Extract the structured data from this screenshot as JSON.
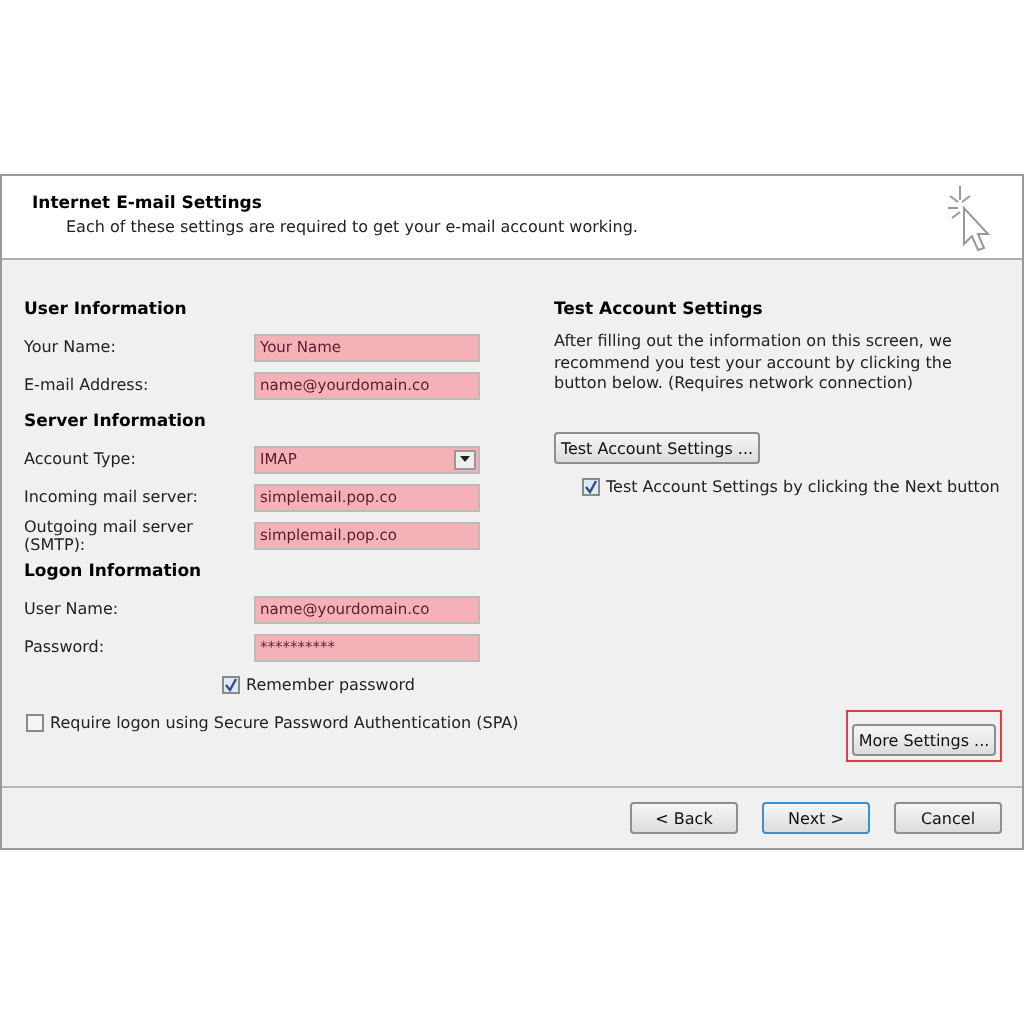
{
  "header": {
    "title": "Internet E-mail Settings",
    "subtitle": "Each of these settings are required to get your e-mail account working."
  },
  "sections": [
    {
      "title": "User Information",
      "fields": [
        {
          "kind": "text",
          "label": "Your Name:",
          "value": "Your Name",
          "highlighted": true
        },
        {
          "kind": "text",
          "label": "E-mail Address:",
          "value": "name@yourdomain.co",
          "highlighted": true
        }
      ]
    },
    {
      "title": "Server Information",
      "fields": [
        {
          "kind": "select",
          "label": "Account Type:",
          "value": "IMAP",
          "highlighted": true
        },
        {
          "kind": "text",
          "label": "Incoming mail server:",
          "value": "simplemail.pop.co",
          "highlighted": true
        },
        {
          "kind": "text",
          "label": "Outgoing mail server (SMTP):",
          "value": "simplemail.pop.co",
          "highlighted": true
        }
      ]
    },
    {
      "title": "Logon Information",
      "fields": [
        {
          "kind": "text",
          "label": "User Name:",
          "value": "name@yourdomain.co",
          "highlighted": true
        },
        {
          "kind": "text",
          "label": "Password:",
          "value": "**********",
          "highlighted": true
        }
      ]
    }
  ],
  "remember_password": {
    "label": "Remember password",
    "checked": true
  },
  "spa": {
    "label": "Require logon using Secure Password Authentication (SPA)",
    "checked": false
  },
  "test": {
    "title": "Test Account Settings",
    "description": "After filling out the information on this screen, we recommend you test your account by clicking the button below. (Requires network connection)",
    "button": "Test Account Settings ...",
    "auto_test": {
      "label": "Test Account Settings by clicking the Next button",
      "checked": true
    }
  },
  "more_settings": {
    "label": "More Settings ...",
    "highlighted": true
  },
  "buttons": [
    {
      "label": "< Back",
      "default": false
    },
    {
      "label": "Next >",
      "default": true
    },
    {
      "label": "Cancel",
      "default": false
    }
  ]
}
